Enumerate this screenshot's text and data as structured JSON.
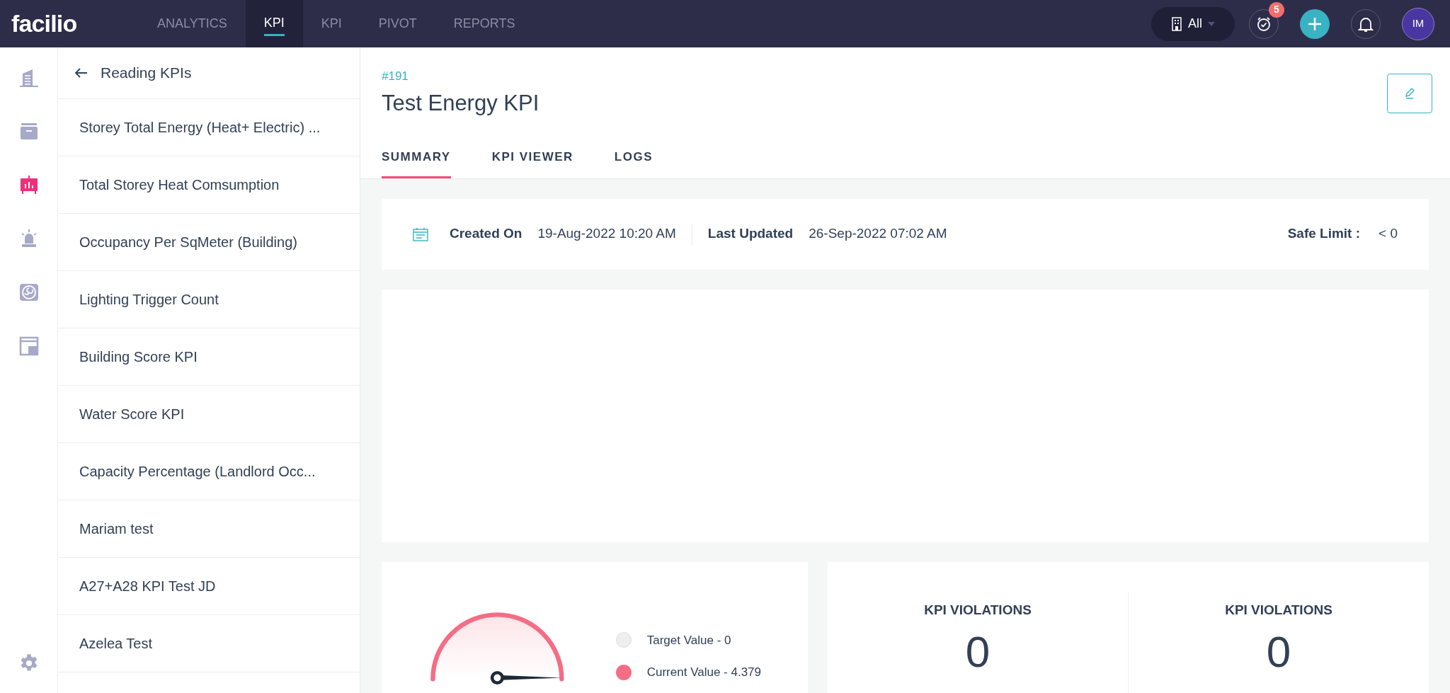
{
  "topbar": {
    "logo": "facilio",
    "nav": [
      {
        "label": "ANALYTICS",
        "selected": false
      },
      {
        "label": "KPI",
        "selected": true
      },
      {
        "label": "KPI",
        "selected": false
      },
      {
        "label": "PIVOT",
        "selected": false
      },
      {
        "label": "REPORTS",
        "selected": false
      }
    ],
    "site_picker": "All",
    "timer_badge": "5",
    "avatar": "IM"
  },
  "rail": [
    {
      "kind": "building",
      "selected": false
    },
    {
      "kind": "inbox",
      "selected": false
    },
    {
      "kind": "chart",
      "selected": true
    },
    {
      "kind": "alarm",
      "selected": false
    },
    {
      "kind": "fan",
      "selected": false
    },
    {
      "kind": "window",
      "selected": false
    }
  ],
  "list": {
    "title": "Reading KPIs",
    "items": [
      {
        "label": "Storey Total Energy (Heat+ Electric) ...",
        "selected": false
      },
      {
        "label": "Total Storey Heat Comsumption",
        "selected": false
      },
      {
        "label": "Occupancy Per SqMeter (Building)",
        "selected": false
      },
      {
        "label": "Lighting Trigger Count",
        "selected": false
      },
      {
        "label": "Building Score KPI",
        "selected": false
      },
      {
        "label": "Water Score KPI",
        "selected": false
      },
      {
        "label": "Capacity Percentage (Landlord Occ...",
        "selected": false
      },
      {
        "label": "Mariam test",
        "selected": false
      },
      {
        "label": "A27+A28 KPI Test JD",
        "selected": false
      },
      {
        "label": "Azelea Test",
        "selected": false
      }
    ]
  },
  "detail": {
    "id": "#191",
    "title": "Test Energy KPI",
    "tabs": [
      {
        "label": "SUMMARY",
        "selected": true
      },
      {
        "label": "KPI VIEWER",
        "selected": false
      },
      {
        "label": "LOGS",
        "selected": false
      }
    ],
    "info": {
      "created_label": "Created On",
      "created": "19-Aug-2022 10:20 AM",
      "updated_label": "Last Updated",
      "updated": "26-Sep-2022 07:02 AM",
      "limit_label": "Safe Limit :",
      "limit": "< 0"
    },
    "gauge": {
      "legend": [
        {
          "label": "Target Value - 0",
          "color": "#eeeeee"
        },
        {
          "label": "Current Value - 4.379",
          "color": "#f56d85"
        }
      ]
    },
    "violations": [
      {
        "label": "KPI VIOLATIONS",
        "value": "0"
      },
      {
        "label": "KPI VIOLATIONS",
        "value": "0"
      }
    ]
  }
}
